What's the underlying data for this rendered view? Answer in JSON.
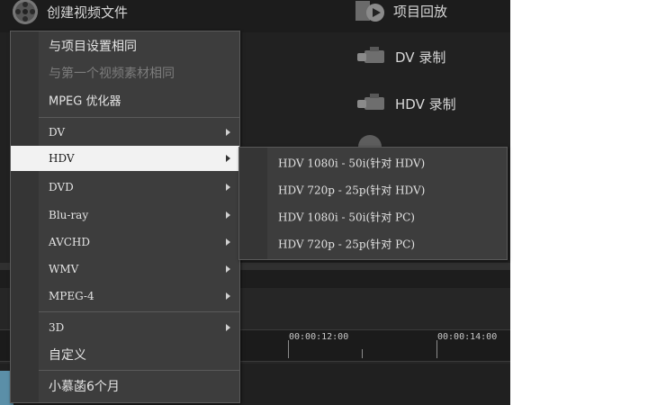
{
  "top": {
    "create_label": "创建视频文件"
  },
  "right_panel": {
    "playback_label": "项目回放",
    "dv_record_label": "DV 录制",
    "hdv_record_label": "HDV 录制"
  },
  "timeline": {
    "timecodes": [
      "00:00:12:00",
      "00:00:14:00"
    ]
  },
  "menu": {
    "items": [
      {
        "label": "与项目设置相同",
        "disabled": false,
        "submenu": false
      },
      {
        "label": "与第一个视频素材相同",
        "disabled": true,
        "submenu": false
      },
      {
        "label": "MPEG 优化器",
        "disabled": false,
        "submenu": false
      },
      {
        "label": "DV",
        "disabled": false,
        "submenu": true
      },
      {
        "label": "HDV",
        "disabled": false,
        "submenu": true,
        "selected": true
      },
      {
        "label": "DVD",
        "disabled": false,
        "submenu": true
      },
      {
        "label": "Blu-ray",
        "disabled": false,
        "submenu": true
      },
      {
        "label": "AVCHD",
        "disabled": false,
        "submenu": true
      },
      {
        "label": "WMV",
        "disabled": false,
        "submenu": true
      },
      {
        "label": "MPEG-4",
        "disabled": false,
        "submenu": true
      },
      {
        "label": "3D",
        "disabled": false,
        "submenu": true
      },
      {
        "label": "自定义",
        "disabled": false,
        "submenu": false
      },
      {
        "label": "小慕菡6个月",
        "disabled": false,
        "submenu": false
      }
    ]
  },
  "submenu": {
    "items": [
      "HDV 1080i - 50i(针对 HDV)",
      "HDV 720p - 25p(针对 HDV)",
      "HDV 1080i - 50i(针对 PC)",
      "HDV 720p - 25p(针对 PC)"
    ]
  }
}
